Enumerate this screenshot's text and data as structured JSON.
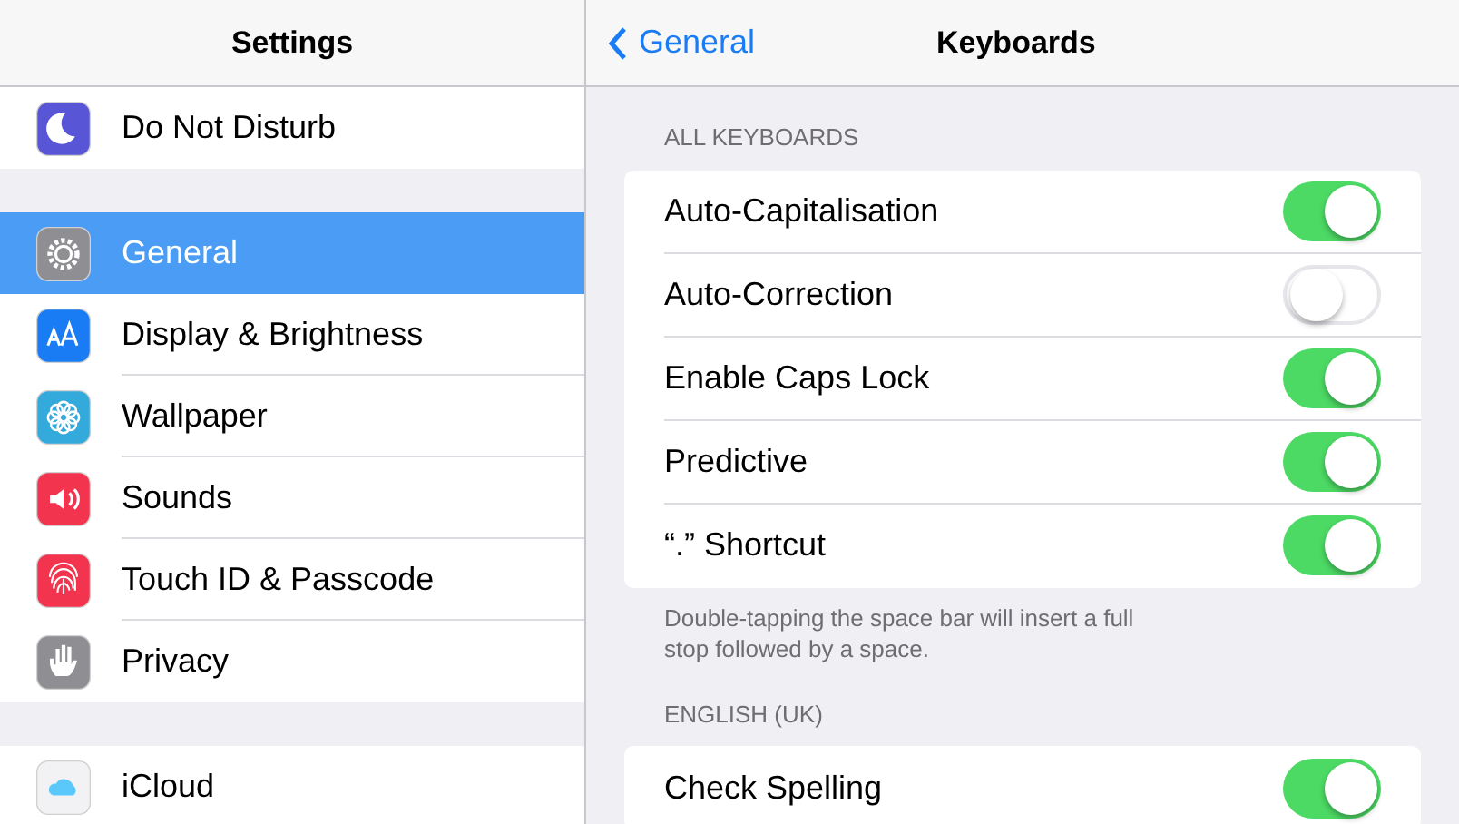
{
  "sidebar": {
    "title": "Settings",
    "groups": [
      {
        "items": [
          {
            "label": "Do Not Disturb",
            "color": "#5856d6",
            "selected": false
          }
        ]
      },
      {
        "items": [
          {
            "label": "General",
            "color": "#8e8e93",
            "selected": true
          },
          {
            "label": "Display & Brightness",
            "color": "#1a7cf5",
            "selected": false
          },
          {
            "label": "Wallpaper",
            "color": "#34aadc",
            "selected": false
          },
          {
            "label": "Sounds",
            "color": "#f2344f",
            "selected": false
          },
          {
            "label": "Touch ID & Passcode",
            "color": "#f2344f",
            "selected": false
          },
          {
            "label": "Privacy",
            "color": "#8e8e93",
            "selected": false
          }
        ]
      },
      {
        "items": [
          {
            "label": "iCloud",
            "color": "#f2f2f4",
            "selected": false
          }
        ]
      }
    ]
  },
  "detail": {
    "back_label": "General",
    "title": "Keyboards",
    "sections": [
      {
        "heading": "ALL KEYBOARDS",
        "rows": [
          {
            "label": "Auto-Capitalisation",
            "on": true
          },
          {
            "label": "Auto-Correction",
            "on": false
          },
          {
            "label": "Enable Caps Lock",
            "on": true
          },
          {
            "label": "Predictive",
            "on": true
          },
          {
            "label": "“.” Shortcut",
            "on": true
          }
        ],
        "footer": "Double-tapping the space bar will insert a full stop followed by a space."
      },
      {
        "heading": "ENGLISH (UK)",
        "rows": [
          {
            "label": "Check Spelling",
            "on": true
          }
        ]
      }
    ]
  }
}
